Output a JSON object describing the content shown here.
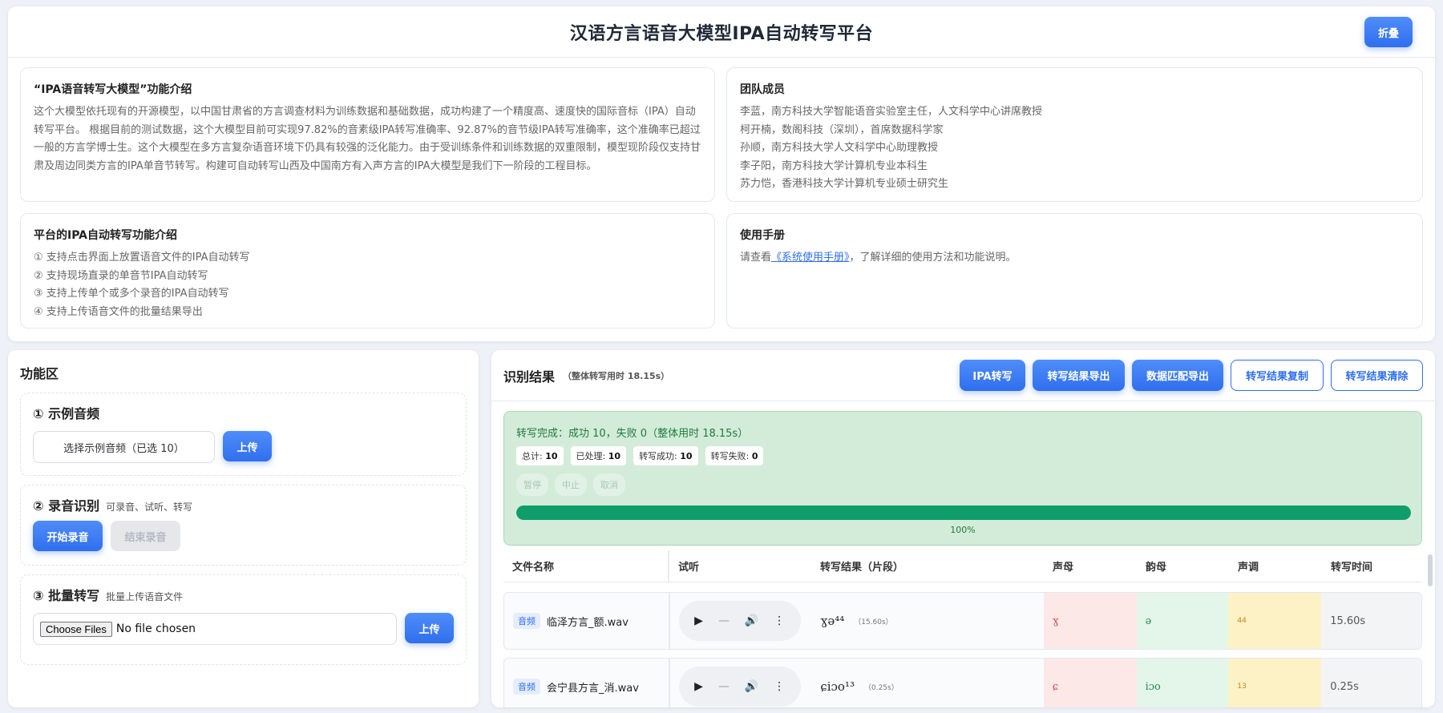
{
  "header": {
    "title": "汉语方言语音大模型IPA自动转写平台",
    "collapse_label": "折叠"
  },
  "intro": {
    "title": "“IPA语音转写大模型”功能介绍",
    "text": "这个大模型依托现有的开源模型，以中国甘肃省的方言调查材料为训练数据和基础数据，成功构建了一个精度高、速度快的国际音标（IPA）自动转写平台。 根据目前的测试数据，这个大模型目前可实现97.82%的音素级IPA转写准确率、92.87%的音节级IPA转写准确率，这个准确率已超过一般的方言学博士生。这个大模型在多方言复杂语音环境下仍具有较强的泛化能力。由于受训练条件和训练数据的双重限制，模型现阶段仅支持甘肃及周边同类方言的IPA单音节转写。构建可自动转写山西及中国南方有入声方言的IPA大模型是我们下一阶段的工程目标。"
  },
  "team": {
    "title": "团队成员",
    "members": [
      "李蓝，南方科技大学智能语音实验室主任，人文科学中心讲席教授",
      "柯开楠，数阁科技（深圳），首席数据科学家",
      "孙顺，南方科技大学人文科学中心助理教授",
      "李子阳，南方科技大学计算机专业本科生",
      "苏力恺，香港科技大学计算机专业硕士研究生"
    ]
  },
  "features": {
    "title": "平台的IPA自动转写功能介绍",
    "items": [
      "① 支持点击界面上放置语音文件的IPA自动转写",
      "② 支持现场直录的单音节IPA自动转写",
      "③ 支持上传单个或多个录音的IPA自动转写",
      "④ 支持上传语音文件的批量结果导出"
    ]
  },
  "manual": {
    "title": "使用手册",
    "prefix": "请查看",
    "link": "《系统使用手册》",
    "suffix": "，了解详细的使用方法和功能说明。"
  },
  "func": {
    "title": "功能区",
    "sample": {
      "title": "① 示例音频",
      "select_label": "选择示例音频（已选 10）",
      "upload_label": "上传"
    },
    "record": {
      "title": "② 录音识别",
      "subtitle": "可录音、试听、转写",
      "start_label": "开始录音",
      "stop_label": "结束录音"
    },
    "batch": {
      "title": "③ 批量转写",
      "subtitle": "批量上传语音文件",
      "choose_label": "Choose Files",
      "no_file": "No file chosen",
      "upload_label": "上传"
    }
  },
  "result": {
    "title": "识别结果",
    "time": "（整体转写用时 18.15s）",
    "actions": {
      "ipa": "IPA转写",
      "export": "转写结果导出",
      "match_export": "数据匹配导出",
      "copy": "转写结果复制",
      "clear": "转写结果清除"
    },
    "status": {
      "line": "转写完成：成功 10，失败 0（整体用时 18.15s）",
      "total_label": "总计:",
      "total": "10",
      "processed_label": "已处理:",
      "processed": "10",
      "success_label": "转写成功:",
      "success": "10",
      "fail_label": "转写失败:",
      "fail": "0",
      "pause": "暂停",
      "stop": "中止",
      "cancel": "取消",
      "progress": 1.0,
      "progress_label": "100%"
    },
    "columns": [
      "文件名称",
      "试听",
      "转写结果（片段）",
      "声母",
      "韵母",
      "声调",
      "转写时间"
    ],
    "rows": [
      {
        "tag": "音频",
        "file": "临泽方言_额.wav",
        "ipa": "ɣə⁴⁴",
        "ipa_sub": "（15.60s）",
        "initial": "ɣ",
        "final": "ə",
        "tone": "44",
        "time": "15.60s"
      },
      {
        "tag": "音频",
        "file": "会宁县方言_消.wav",
        "ipa": "ɕiɔo¹³",
        "ipa_sub": "（0.25s）",
        "initial": "ɕ",
        "final": "iɔo",
        "tone": "13",
        "time": "0.25s"
      }
    ]
  },
  "colors": {
    "primary": "#2f6fed",
    "success_bg": "#d3ecd9",
    "progress": "#0f9d6b"
  }
}
